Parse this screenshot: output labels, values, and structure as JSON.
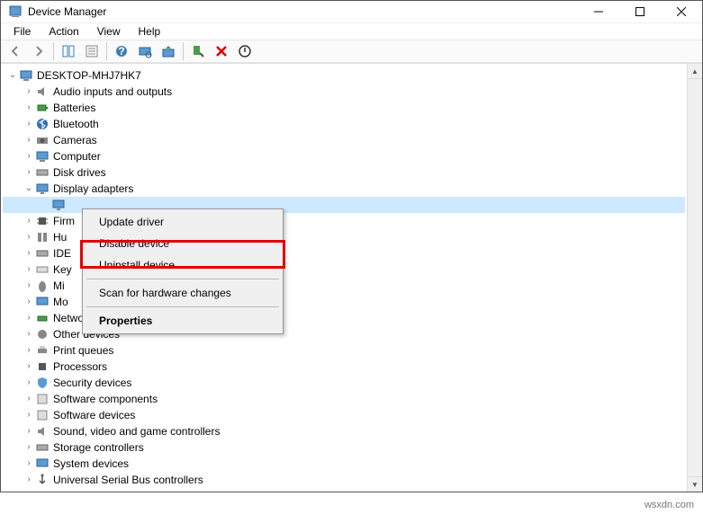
{
  "window": {
    "title": "Device Manager"
  },
  "menu": {
    "file": "File",
    "action": "Action",
    "view": "View",
    "help": "Help"
  },
  "root": "DESKTOP-MHJ7HK7",
  "cats": {
    "audio": "Audio inputs and outputs",
    "batteries": "Batteries",
    "bluetooth": "Bluetooth",
    "cameras": "Cameras",
    "computer": "Computer",
    "disk": "Disk drives",
    "display": "Display adapters",
    "firm": "Firm",
    "hu": "Hu",
    "ide": "IDE",
    "key": "Key",
    "mi": "Mi",
    "mo": "Mo",
    "netadapt": "Network adapters",
    "other": "Other devices",
    "printq": "Print queues",
    "proc": "Processors",
    "security": "Security devices",
    "swcomp": "Software components",
    "swdev": "Software devices",
    "sound": "Sound, video and game controllers",
    "storage": "Storage controllers",
    "sysdev": "System devices",
    "usb": "Universal Serial Bus controllers"
  },
  "ctx": {
    "update": "Update driver",
    "disable": "Disable device",
    "uninstall": "Uninstall device",
    "scan": "Scan for hardware changes",
    "props": "Properties"
  },
  "watermark": "wsxdn.com"
}
